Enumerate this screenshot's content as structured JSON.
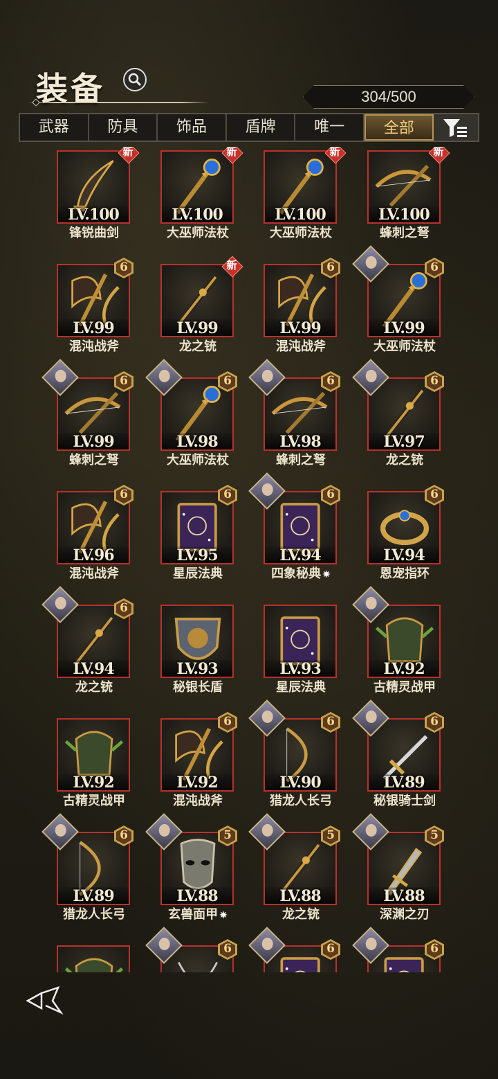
{
  "header": {
    "title": "装备",
    "capacity": "304/500"
  },
  "tabs": [
    {
      "label": "武器"
    },
    {
      "label": "防具"
    },
    {
      "label": "饰品"
    },
    {
      "label": "盾牌"
    },
    {
      "label": "唯一"
    },
    {
      "label": "全部"
    }
  ],
  "active_tab": "全部",
  "colors": {
    "frame_red": "#b8312c",
    "gold": "#c8a24c",
    "active_tab_text": "#f2cf7b"
  },
  "items": [
    {
      "level": "LV.100",
      "name": "锋锐曲剑",
      "badge": "新",
      "portrait": false,
      "icon": "scimitar-icon"
    },
    {
      "level": "LV.100",
      "name": "大巫师法杖",
      "badge": "新",
      "portrait": false,
      "icon": "staff-icon"
    },
    {
      "level": "LV.100",
      "name": "大巫师法杖",
      "badge": "新",
      "portrait": false,
      "icon": "staff-icon"
    },
    {
      "level": "LV.100",
      "name": "蜂刺之弩",
      "badge": "新",
      "portrait": false,
      "icon": "crossbow-icon"
    },
    {
      "level": "LV.99",
      "name": "混沌战斧",
      "badge": "6",
      "portrait": false,
      "icon": "axe-icon"
    },
    {
      "level": "LV.99",
      "name": "龙之铳",
      "badge": "新",
      "portrait": false,
      "icon": "gun-icon"
    },
    {
      "level": "LV.99",
      "name": "混沌战斧",
      "badge": "6",
      "portrait": false,
      "icon": "axe-icon"
    },
    {
      "level": "LV.99",
      "name": "大巫师法杖",
      "badge": "6",
      "portrait": true,
      "icon": "staff-icon"
    },
    {
      "level": "LV.99",
      "name": "蜂刺之弩",
      "badge": "6",
      "portrait": true,
      "icon": "crossbow-icon"
    },
    {
      "level": "LV.98",
      "name": "大巫师法杖",
      "badge": "6",
      "portrait": true,
      "icon": "staff-icon"
    },
    {
      "level": "LV.98",
      "name": "蜂刺之弩",
      "badge": "6",
      "portrait": true,
      "icon": "crossbow-icon"
    },
    {
      "level": "LV.97",
      "name": "龙之铳",
      "badge": "6",
      "portrait": true,
      "icon": "gun-icon"
    },
    {
      "level": "LV.96",
      "name": "混沌战斧",
      "badge": "6",
      "portrait": false,
      "icon": "axe-icon"
    },
    {
      "level": "LV.95",
      "name": "星辰法典",
      "badge": "6",
      "portrait": false,
      "icon": "tome-icon"
    },
    {
      "level": "LV.94",
      "name": "四象秘典",
      "badge": "6",
      "portrait": true,
      "icon": "tome-icon",
      "sparkle": true
    },
    {
      "level": "LV.94",
      "name": "恩宠指环",
      "badge": "6",
      "portrait": false,
      "icon": "ring-icon"
    },
    {
      "level": "LV.94",
      "name": "龙之铳",
      "badge": "6",
      "portrait": true,
      "icon": "gun-icon"
    },
    {
      "level": "LV.93",
      "name": "秘银长盾",
      "badge": "",
      "portrait": false,
      "icon": "shield-icon"
    },
    {
      "level": "LV.93",
      "name": "星辰法典",
      "badge": "",
      "portrait": false,
      "icon": "tome-icon"
    },
    {
      "level": "LV.92",
      "name": "古精灵战甲",
      "badge": "",
      "portrait": true,
      "icon": "armor-icon"
    },
    {
      "level": "LV.92",
      "name": "古精灵战甲",
      "badge": "",
      "portrait": false,
      "icon": "armor-icon"
    },
    {
      "level": "LV.92",
      "name": "混沌战斧",
      "badge": "6",
      "portrait": false,
      "icon": "axe-icon"
    },
    {
      "level": "LV.90",
      "name": "猎龙人长弓",
      "badge": "6",
      "portrait": true,
      "icon": "bow-icon"
    },
    {
      "level": "LV.89",
      "name": "秘银骑士剑",
      "badge": "6",
      "portrait": true,
      "icon": "sword-icon"
    },
    {
      "level": "LV.89",
      "name": "猎龙人长弓",
      "badge": "6",
      "portrait": true,
      "icon": "bow-icon"
    },
    {
      "level": "LV.88",
      "name": "玄兽面甲",
      "badge": "5",
      "portrait": true,
      "icon": "mask-icon",
      "sparkle": true
    },
    {
      "level": "LV.88",
      "name": "龙之铳",
      "badge": "5",
      "portrait": true,
      "icon": "gun-icon"
    },
    {
      "level": "LV.88",
      "name": "深渊之刃",
      "badge": "5",
      "portrait": true,
      "icon": "blade-icon"
    },
    {
      "level": "",
      "name": "",
      "badge": "",
      "portrait": false,
      "icon": "armor-icon"
    },
    {
      "level": "",
      "name": "",
      "badge": "6",
      "portrait": true,
      "icon": "necklace-icon"
    },
    {
      "level": "",
      "name": "",
      "badge": "6",
      "portrait": true,
      "icon": "tome-icon"
    },
    {
      "level": "",
      "name": "",
      "badge": "6",
      "portrait": true,
      "icon": "tome-icon"
    }
  ]
}
